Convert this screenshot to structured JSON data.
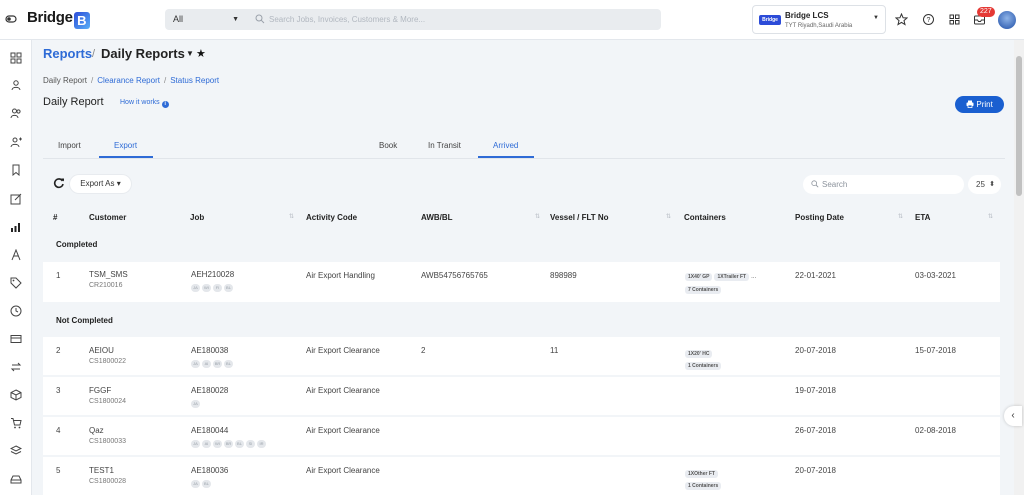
{
  "app": {
    "logo": "Bridge",
    "logo_mark": "B"
  },
  "topbar": {
    "scope": "All",
    "search_placeholder": "Search Jobs, Invoices, Customers & More...",
    "company_name": "Bridge LCS",
    "company_address": "TYT Riyadh,Saudi Arabia",
    "company_logo_text": "Bridge",
    "notification_count": "227"
  },
  "header": {
    "reports": "Reports",
    "sep": "/",
    "daily": "Daily Reports"
  },
  "subnav": {
    "daily": "Daily Report",
    "clearance": "Clearance Report",
    "status": "Status Report"
  },
  "page": {
    "title": "Daily Report",
    "how": "How it works",
    "print": "Print"
  },
  "tabs": {
    "import": "Import",
    "export": "Export",
    "book": "Book",
    "in_transit": "In Transit",
    "arrived": "Arrived"
  },
  "toolbar": {
    "export_as": "Export As",
    "search_placeholder": "Search",
    "page_size": "25"
  },
  "columns": {
    "num": "#",
    "customer": "Customer",
    "job": "Job",
    "activity": "Activity Code",
    "awb": "AWB/BL",
    "vessel": "Vessel / FLT No",
    "containers": "Containers",
    "posting": "Posting Date",
    "eta": "ETA"
  },
  "sections": {
    "completed": "Completed",
    "not_completed": "Not Completed"
  },
  "rows": [
    {
      "num": "1",
      "customer": "TSM_SMS",
      "code": "CR210016",
      "job": "AEH210028",
      "activity": "Air Export Handling",
      "awb": "AWB54756765765",
      "vessel": "898989",
      "tags": [
        "1X40' GP",
        "1XTrailer FT",
        "..."
      ],
      "count": "7 Containers",
      "posting": "22-01-2021",
      "eta": "03-03-2021"
    },
    {
      "num": "2",
      "customer": "AEIOU",
      "code": "CS1800022",
      "job": "AE180038",
      "activity": "Air Export Clearance",
      "awb": "2",
      "vessel": "11",
      "tags": [
        "1X20' HC"
      ],
      "count": "1 Containers",
      "posting": "20-07-2018",
      "eta": "15-07-2018"
    },
    {
      "num": "3",
      "customer": "FGGF",
      "code": "CS1800024",
      "job": "AE180028",
      "activity": "Air Export Clearance",
      "awb": "",
      "vessel": "",
      "tags": [],
      "count": "",
      "posting": "19-07-2018",
      "eta": ""
    },
    {
      "num": "4",
      "customer": "Qaz",
      "code": "CS1800033",
      "job": "AE180044",
      "activity": "Air Export Clearance",
      "awb": "",
      "vessel": "",
      "tags": [],
      "count": "",
      "posting": "26-07-2018",
      "eta": "02-08-2018"
    },
    {
      "num": "5",
      "customer": "TEST1",
      "code": "CS1800028",
      "job": "AE180036",
      "activity": "Air Export Clearance",
      "awb": "",
      "vessel": "",
      "tags": [
        "1XOther FT"
      ],
      "count": "1 Containers",
      "posting": "20-07-2018",
      "eta": ""
    }
  ],
  "colors": {
    "accent": "#2e6bd6",
    "print": "#1a5fd0",
    "badge": "#e53935"
  }
}
